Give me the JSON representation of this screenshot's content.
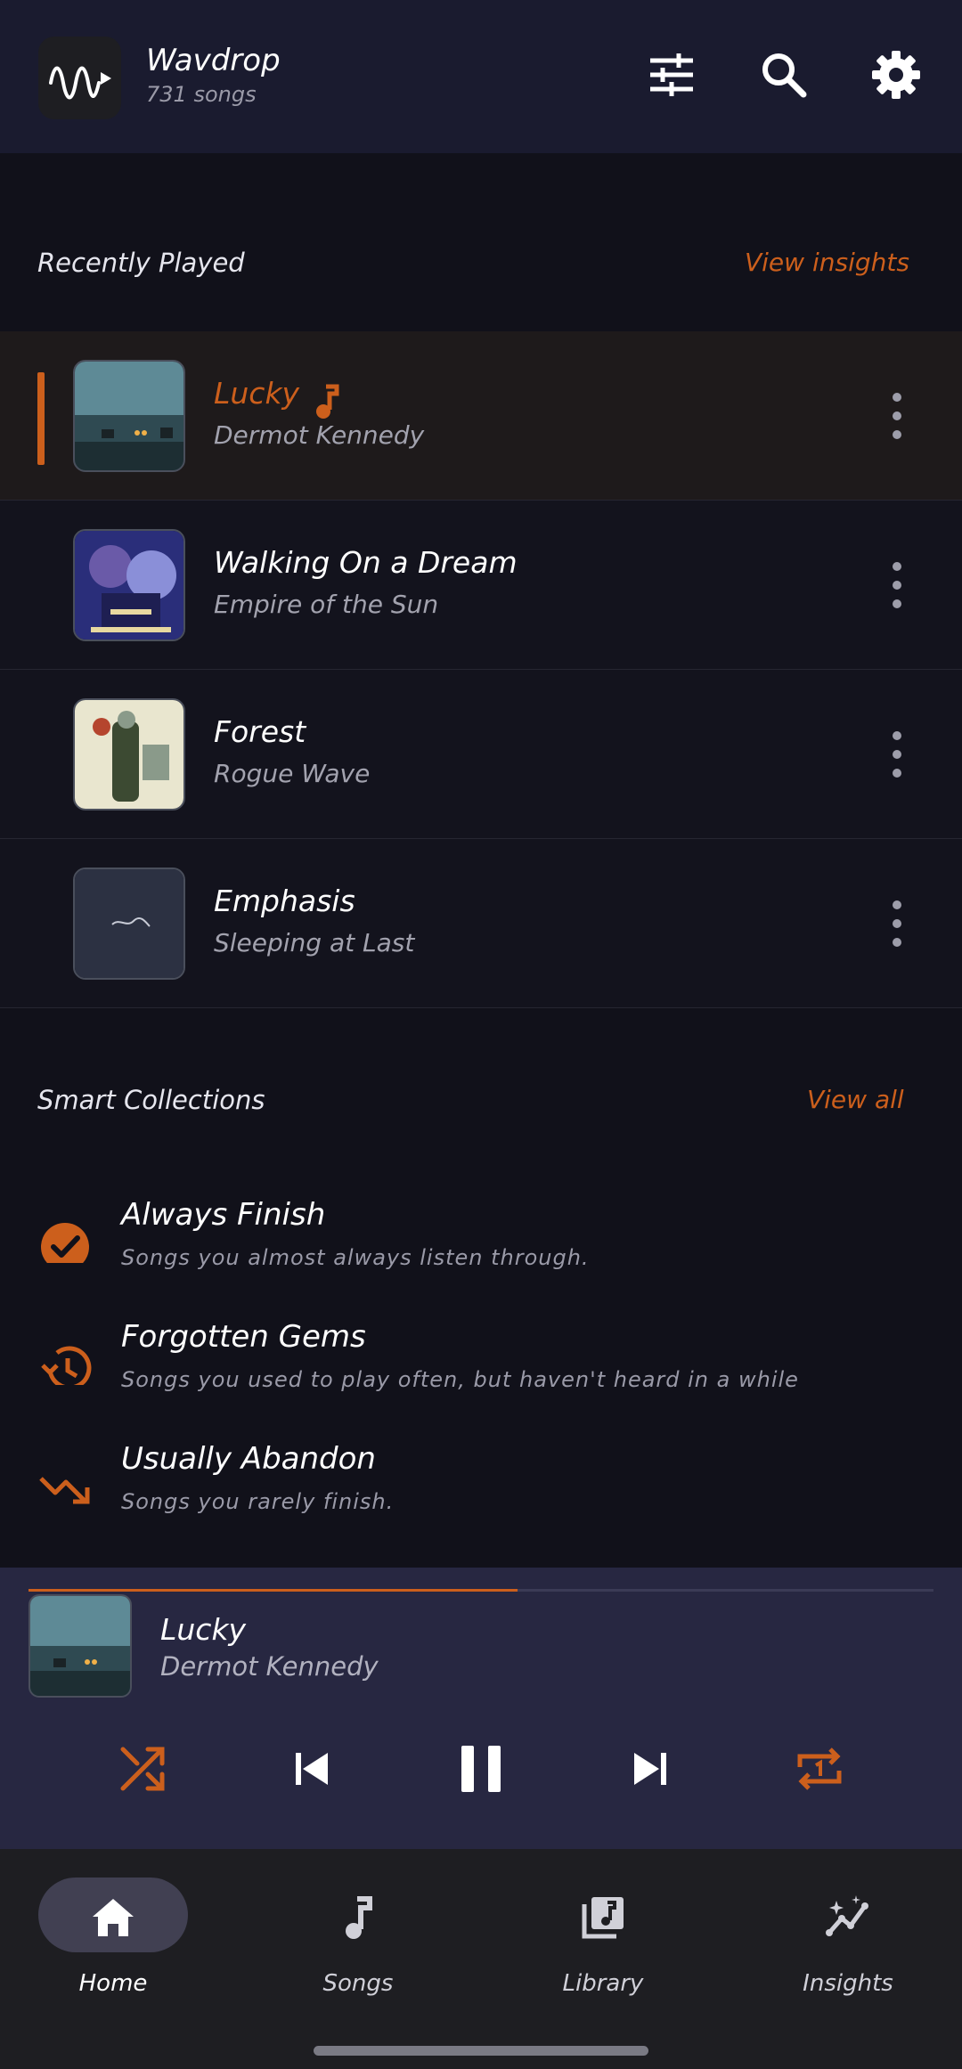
{
  "header": {
    "app_name": "Wavdrop",
    "song_count": "731 songs",
    "icons": [
      "sliders-icon",
      "search-icon",
      "gear-icon"
    ]
  },
  "recently_played": {
    "title": "Recently Played",
    "link": "View insights",
    "songs": [
      {
        "title": "Lucky",
        "artist": "Dermot Kennedy",
        "playing": true
      },
      {
        "title": "Walking On a Dream",
        "artist": "Empire of the Sun",
        "playing": false
      },
      {
        "title": "Forest",
        "artist": "Rogue Wave",
        "playing": false
      },
      {
        "title": "Emphasis",
        "artist": "Sleeping at Last",
        "playing": false
      }
    ]
  },
  "smart_collections": {
    "title": "Smart Collections",
    "link": "View all",
    "items": [
      {
        "title": "Always Finish",
        "desc": "Songs you almost always listen through.",
        "icon": "check-circle-icon"
      },
      {
        "title": "Forgotten Gems",
        "desc": "Songs you used to play often, but haven't heard in a while",
        "icon": "history-icon"
      },
      {
        "title": "Usually Abandon",
        "desc": "Songs you rarely finish.",
        "icon": "trending-down-icon"
      }
    ]
  },
  "now_playing": {
    "title": "Lucky",
    "artist": "Dermot Kennedy",
    "progress": 0.54,
    "controls": [
      "shuffle-icon",
      "previous-icon",
      "pause-icon",
      "next-icon",
      "repeat-one-icon"
    ]
  },
  "nav": {
    "items": [
      {
        "label": "Home",
        "icon": "home-icon",
        "active": true
      },
      {
        "label": "Songs",
        "icon": "music-note-icon",
        "active": false
      },
      {
        "label": "Library",
        "icon": "library-icon",
        "active": false
      },
      {
        "label": "Insights",
        "icon": "insights-icon",
        "active": false
      }
    ]
  },
  "colors": {
    "accent": "#cc5f1c",
    "header_bg": "#1a1b2f",
    "player_bg": "#272741",
    "nav_bg": "#1e1e22"
  }
}
